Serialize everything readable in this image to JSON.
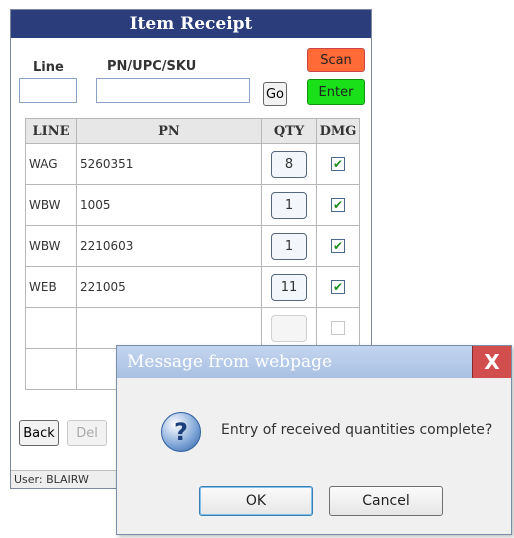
{
  "app": {
    "title": "Item Receipt",
    "status": "User: BLAIRW"
  },
  "form": {
    "line_label": "Line",
    "pn_label": "PN/UPC/SKU",
    "line_value": "",
    "pn_value": "",
    "go_label": "Go",
    "scan_label": "Scan",
    "enter_label": "Enter"
  },
  "table": {
    "columns": [
      "LINE",
      "PN",
      "QTY",
      "DMG"
    ],
    "rows": [
      {
        "line": "WAG",
        "pn": "5260351",
        "qty": "8",
        "dmg": true
      },
      {
        "line": "WBW",
        "pn": "1005",
        "qty": "1",
        "dmg": true
      },
      {
        "line": "WBW",
        "pn": "2210603",
        "qty": "1",
        "dmg": true
      },
      {
        "line": "WEB",
        "pn": "221005",
        "qty": "11",
        "dmg": true
      },
      {
        "line": "",
        "pn": "",
        "qty": "",
        "dmg": false
      },
      {
        "line": "",
        "pn": "",
        "qty": "",
        "dmg": false
      }
    ]
  },
  "footer": {
    "back_label": "Back",
    "del_label": "Del"
  },
  "dialog": {
    "title": "Message from webpage",
    "close_glyph": "X",
    "icon_glyph": "?",
    "message": "Entry of received quantities complete?",
    "ok_label": "OK",
    "cancel_label": "Cancel"
  },
  "colors": {
    "title_bar": "#2b3d7a",
    "scan": "#ff6a36",
    "enter": "#19e019",
    "check": "#1f8a1f"
  }
}
